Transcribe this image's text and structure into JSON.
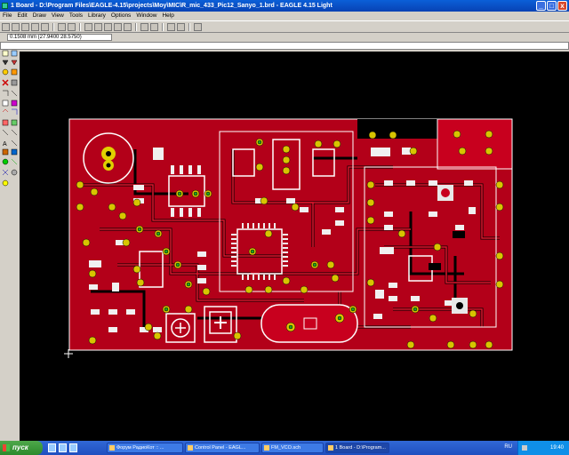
{
  "window": {
    "title": "1 Board - D:\\Program Files\\EAGLE-4.15\\projects\\Moy\\MIC\\R_mic_433_Pic12_Sanyo_1.brd - EAGLE 4.15 Light",
    "minimize": "_",
    "maximize": "□",
    "close": "x"
  },
  "menu": [
    "File",
    "Edit",
    "Draw",
    "View",
    "Tools",
    "Library",
    "Options",
    "Window",
    "Help"
  ],
  "coord": "0.1508 mm (27.9400 28.5750)",
  "colors": {
    "board": "#b00018",
    "copper_top": "#c8001e",
    "pads": "#c8b400",
    "silk": "#ffffff",
    "canvas": "#000000"
  },
  "taskbar": {
    "start": "пуск",
    "tasks": [
      "Форум РадиоКот :: ...",
      "Control Panel - EAGL...",
      "FM_VCO.sch",
      "1 Board - D:\\Program..."
    ],
    "lang": "RU",
    "time": "19:40"
  }
}
